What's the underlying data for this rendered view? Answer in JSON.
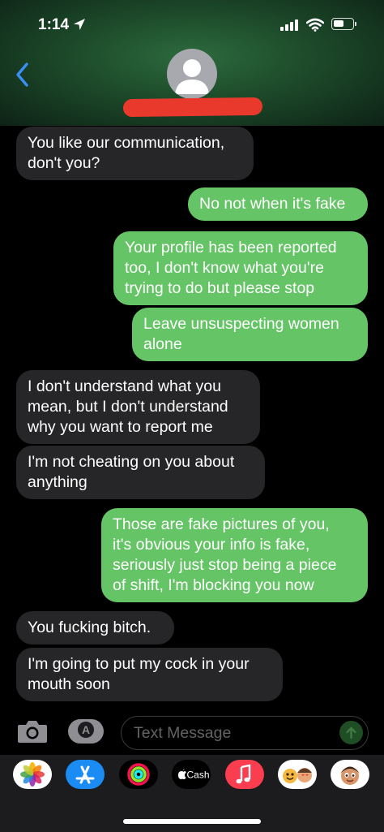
{
  "status_bar": {
    "time": "1:14"
  },
  "messages": [
    {
      "side": "in",
      "lines": [
        "You like our communication,",
        "don't you?"
      ]
    },
    {
      "side": "out",
      "lines": [
        "No not when it's fake"
      ]
    },
    {
      "side": "out",
      "lines": [
        "Your profile has been reported",
        "too, I don't know what you're",
        "trying to do but please stop"
      ]
    },
    {
      "side": "out",
      "lines": [
        "Leave unsuspecting women",
        "alone"
      ]
    },
    {
      "side": "in",
      "lines": [
        "I don't understand what you",
        "mean, but I don't understand",
        "why you want to report me"
      ]
    },
    {
      "side": "in",
      "lines": [
        "I'm not cheating on you about",
        "anything"
      ]
    },
    {
      "side": "out",
      "lines": [
        "Those are fake pictures of you,",
        "it's obvious your info is fake,",
        "seriously just stop being a piece",
        "of shift, I'm blocking you now"
      ]
    },
    {
      "side": "in",
      "lines": [
        "You fucking bitch."
      ]
    },
    {
      "side": "in",
      "lines": [
        "I'm going to put my cock in your",
        "mouth soon"
      ]
    }
  ],
  "composer": {
    "placeholder": "Text Message"
  },
  "app_tray": [
    {
      "name": "Photos",
      "icon": "photos-icon"
    },
    {
      "name": "App Store",
      "icon": "app-store-icon"
    },
    {
      "name": "Fitness",
      "icon": "activity-rings-icon"
    },
    {
      "name": "Cash",
      "label": "Cash",
      "icon": "apple-cash-icon"
    },
    {
      "name": "Music",
      "icon": "music-icon"
    },
    {
      "name": "Memoji",
      "icon": "memoji-icon"
    },
    {
      "name": "Memoji 2",
      "icon": "memoji-icon"
    }
  ],
  "colors": {
    "incoming": "#262628",
    "outgoing": "#65c466",
    "redaction": "#e8392c",
    "back_chevron": "#3a8ef7"
  }
}
